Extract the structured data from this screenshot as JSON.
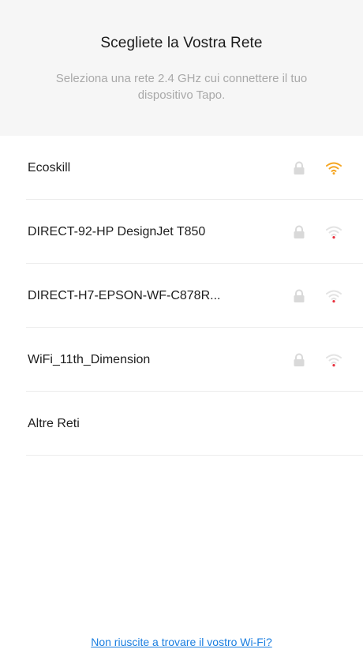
{
  "header": {
    "title": "Scegliete la Vostra Rete",
    "subtitle": "Seleziona una rete 2.4 GHz cui connettere il tuo dispositivo Tapo."
  },
  "networks": [
    {
      "name": "Ecoskill",
      "secured": true,
      "signal_color": "#f5a623",
      "lock_icon": "lock-icon",
      "signal_icon": "wifi-signal-icon"
    },
    {
      "name": "DIRECT-92-HP DesignJet T850",
      "secured": true,
      "signal_color": "#e8313f",
      "lock_icon": "lock-icon",
      "signal_icon": "wifi-signal-icon"
    },
    {
      "name": "DIRECT-H7-EPSON-WF-C878R...",
      "secured": true,
      "signal_color": "#e8313f",
      "lock_icon": "lock-icon",
      "signal_icon": "wifi-signal-icon"
    },
    {
      "name": "WiFi_11th_Dimension",
      "secured": true,
      "signal_color": "#e8313f",
      "lock_icon": "lock-icon",
      "signal_icon": "wifi-signal-icon"
    }
  ],
  "other_networks": {
    "label": "Altre Reti"
  },
  "help": {
    "link_label": "Non riuscite a trovare il vostro Wi-Fi?"
  },
  "colors": {
    "link": "#1a7ee0",
    "strong_signal": "#f5a623",
    "weak_signal": "#e8313f",
    "lock": "#d9d9d9"
  }
}
